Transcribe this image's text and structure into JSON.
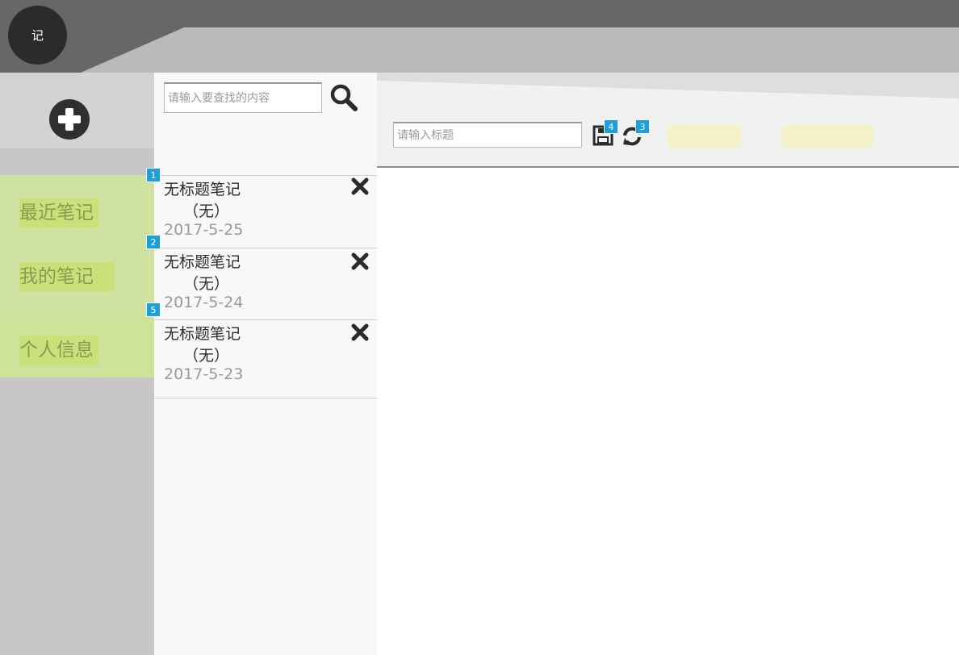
{
  "header": {
    "logo_text": "记"
  },
  "sidebar": {
    "add_icon": "plus-circle-icon",
    "items": [
      {
        "label": "最近笔记"
      },
      {
        "label": "我的笔记"
      },
      {
        "label": "个人信息"
      }
    ]
  },
  "search": {
    "placeholder": "请输入要查找的内容",
    "icon": "search-icon"
  },
  "notes": [
    {
      "badge": "1",
      "title": "无标题笔记",
      "summary": "（无）",
      "date": "2017-5-25"
    },
    {
      "badge": "2",
      "title": "无标题笔记",
      "summary": "（无）",
      "date": "2017-5-24"
    },
    {
      "badge": "5",
      "title": "无标题笔记",
      "summary": "（无）",
      "date": "2017-5-23"
    }
  ],
  "editor": {
    "title_placeholder": "请输入标题",
    "save_badge": "4",
    "refresh_badge": "3",
    "save_icon": "floppy-disk-icon",
    "refresh_icon": "refresh-icon"
  },
  "colors": {
    "header_dark": "#676767",
    "header_light": "#bababa",
    "nav_highlight": "#c9e178",
    "nav_text": "#8a9a55",
    "badge": "#1e9fd8",
    "yellow_button": "#f3f3c7"
  }
}
